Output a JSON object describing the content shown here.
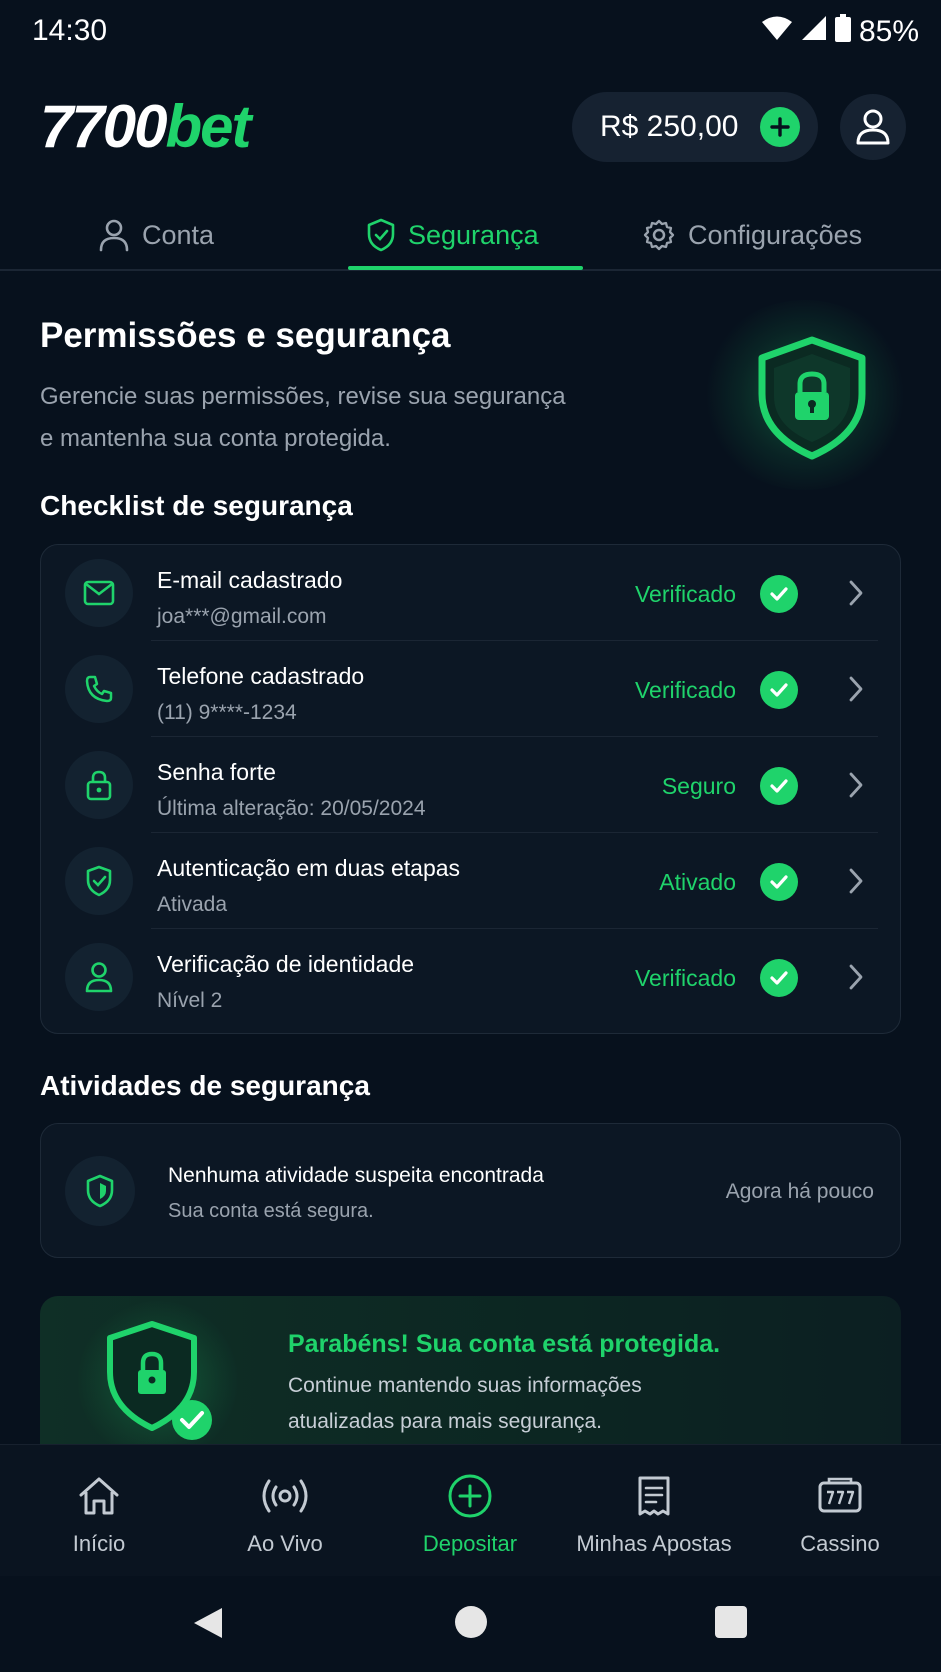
{
  "status_bar": {
    "time": "14:30",
    "battery": "85%"
  },
  "header": {
    "logo_part1": "7700",
    "logo_part2": "bet",
    "balance": "R$ 250,00"
  },
  "tabs": [
    {
      "label": "Conta",
      "icon": "user-icon"
    },
    {
      "label": "Segurança",
      "icon": "shield-icon",
      "active": true
    },
    {
      "label": "Configurações",
      "icon": "gear-icon"
    }
  ],
  "hero": {
    "title": "Permissões e segurança",
    "subtitle": "Gerencie suas permissões, revise sua segurança e mantenha sua conta protegida."
  },
  "checklist": {
    "title": "Checklist de segurança",
    "items": [
      {
        "title": "E-mail cadastrado",
        "subtitle": "joa***@gmail.com",
        "status": "Verificado",
        "icon": "mail-icon"
      },
      {
        "title": "Telefone cadastrado",
        "subtitle": "(11) 9****-1234",
        "status": "Verificado",
        "icon": "phone-icon"
      },
      {
        "title": "Senha forte",
        "subtitle": "Última alteração: 20/05/2024",
        "status": "Seguro",
        "icon": "lock-icon"
      },
      {
        "title": "Autenticação em duas etapas",
        "subtitle": "Ativada",
        "status": "Ativado",
        "icon": "shield-check-icon"
      },
      {
        "title": "Verificação de identidade",
        "subtitle": "Nível 2",
        "status": "Verificado",
        "icon": "user-icon"
      }
    ]
  },
  "activities": {
    "title": "Atividades de segurança",
    "item": {
      "title": "Nenhuma atividade suspeita encontrada",
      "subtitle": "Sua conta está segura.",
      "time": "Agora há pouco"
    }
  },
  "congrats": {
    "title": "Parabéns! Sua conta está protegida.",
    "text": "Continue mantendo suas informações atualizadas para mais segurança."
  },
  "bottom_nav": [
    {
      "label": "Início",
      "icon": "home-icon"
    },
    {
      "label": "Ao Vivo",
      "icon": "live-icon"
    },
    {
      "label": "Depositar",
      "icon": "plus-circle-icon",
      "active": true
    },
    {
      "label": "Minhas Apostas",
      "icon": "receipt-icon"
    },
    {
      "label": "Cassino",
      "icon": "slot-machine-icon"
    }
  ],
  "colors": {
    "accent": "#1fd36b",
    "background": "#07111d",
    "card": "#0c1724",
    "muted_text": "#9aa3ae"
  }
}
